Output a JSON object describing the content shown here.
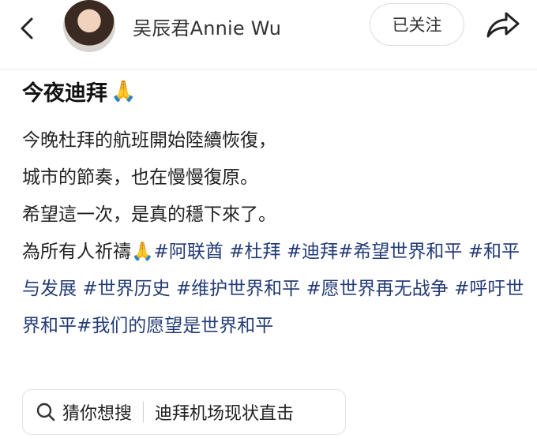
{
  "header": {
    "back_icon": "chevron-left-icon",
    "author_name": "吴辰君Annie Wu",
    "follow_label": "已关注",
    "share_icon": "share-arrow-icon"
  },
  "post": {
    "title": "今夜迪拜",
    "title_emoji": "🙏",
    "lines": [
      "今晚杜拜的航班開始陸續恢復，",
      "城市的節奏，也在慢慢復原。",
      "希望這一次，是真的穩下來了。"
    ],
    "last_line_text": "為所有人祈禱",
    "last_line_emoji": "🙏",
    "tags": [
      "#阿联酋",
      "#杜拜",
      "#迪拜",
      "#希望世界和平",
      "#和平与发展",
      "#世界历史",
      "#维护世界和平",
      "#愿世界再无战争",
      "#呼吁世界和平",
      "#我们的愿望是世界和平"
    ]
  },
  "search": {
    "icon": "search-icon",
    "label": "猜你想搜",
    "query": "迪拜机场现状直击"
  },
  "colors": {
    "tag": "#243c77",
    "text": "#222222",
    "emoji": "#f2b43c"
  }
}
